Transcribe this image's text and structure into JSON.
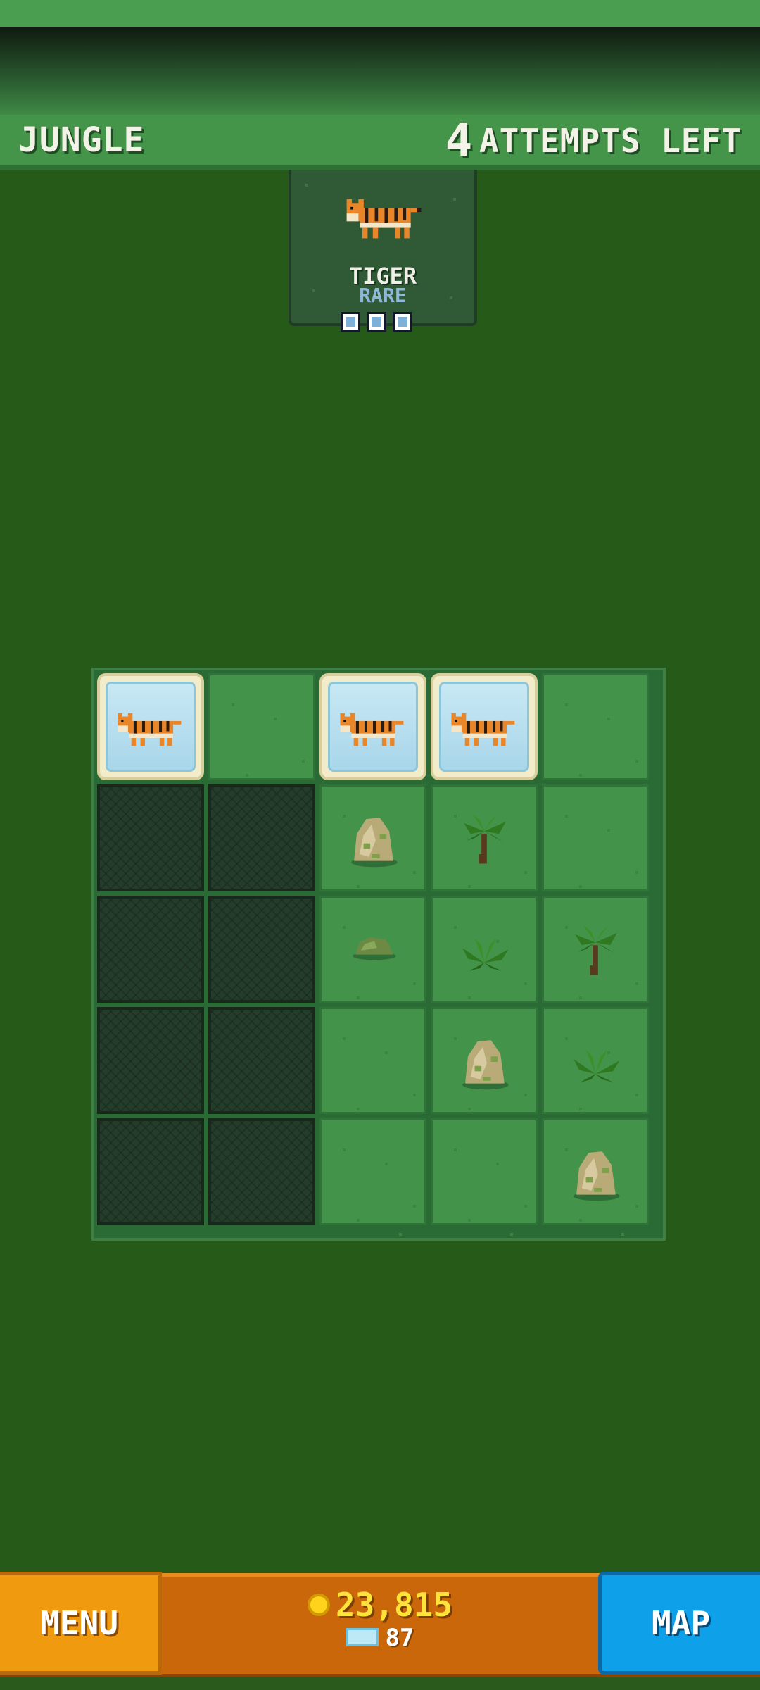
{
  "header": {
    "zone": "JUNGLE",
    "attempts_number": "4",
    "attempts_label": "ATTEMPTS LEFT"
  },
  "target": {
    "animal": "TIGER",
    "rarity": "RARE",
    "progress_total": 3,
    "progress_icon": "blue-square-icon"
  },
  "grid": {
    "rows": 5,
    "cols": 5,
    "cells": [
      [
        "tiger",
        "grass",
        "tiger",
        "tiger",
        "grass"
      ],
      [
        "locked",
        "locked",
        "rock",
        "palm",
        "grass"
      ],
      [
        "locked",
        "locked",
        "bush",
        "fern",
        "palm"
      ],
      [
        "locked",
        "locked",
        "grass",
        "rock",
        "fern"
      ],
      [
        "locked",
        "locked",
        "grass",
        "grass",
        "rock"
      ]
    ]
  },
  "footer": {
    "menu_label": "MENU",
    "map_label": "MAP",
    "coins": "23,815",
    "gems": "87"
  },
  "colors": {
    "background": "#265a18",
    "header": "#44944a",
    "menu": "#f09a10",
    "map": "#0ea0e8",
    "coins_text": "#ffe23a"
  }
}
